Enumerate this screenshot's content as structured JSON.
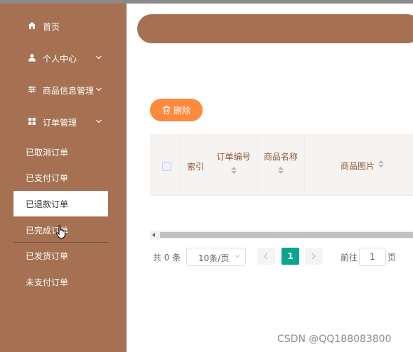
{
  "sidebar": {
    "menu": [
      {
        "label": "首页",
        "icon": "home-icon",
        "has_chevron": false
      },
      {
        "label": "个人中心",
        "icon": "user-icon",
        "has_chevron": true
      },
      {
        "label": "商品信息管理",
        "icon": "sliders-icon",
        "has_chevron": true
      },
      {
        "label": "订单管理",
        "icon": "grid-icon",
        "has_chevron": true
      }
    ],
    "order_submenu": [
      {
        "label": "已取消订单",
        "active": false
      },
      {
        "label": "已支付订单",
        "active": false
      },
      {
        "label": "已退款订单",
        "active": true
      },
      {
        "label": "已完成订单",
        "active": false
      },
      {
        "label": "已发货订单",
        "active": false
      },
      {
        "label": "未支付订单",
        "active": false
      }
    ]
  },
  "toolbar": {
    "delete_label": "删除"
  },
  "table": {
    "columns": [
      {
        "label": "",
        "type": "checkbox"
      },
      {
        "label": "索引",
        "sortable": false
      },
      {
        "label": "订单编号",
        "sortable": true
      },
      {
        "label": "商品名称",
        "sortable": true
      },
      {
        "label": "商品图片",
        "sortable": true
      }
    ],
    "rows": []
  },
  "pagination": {
    "total_text": "共 0 条",
    "page_size": "10条/页",
    "current_page": "1",
    "goto_label": "前往",
    "goto_value": "1",
    "page_unit": "页"
  },
  "watermark": "CSDN @QQ188083800",
  "colors": {
    "sidebar_bg": "#a57152",
    "delete_button": "#ff8a3d",
    "active_page": "#0aa58f",
    "header_text": "#8a5a3c"
  }
}
